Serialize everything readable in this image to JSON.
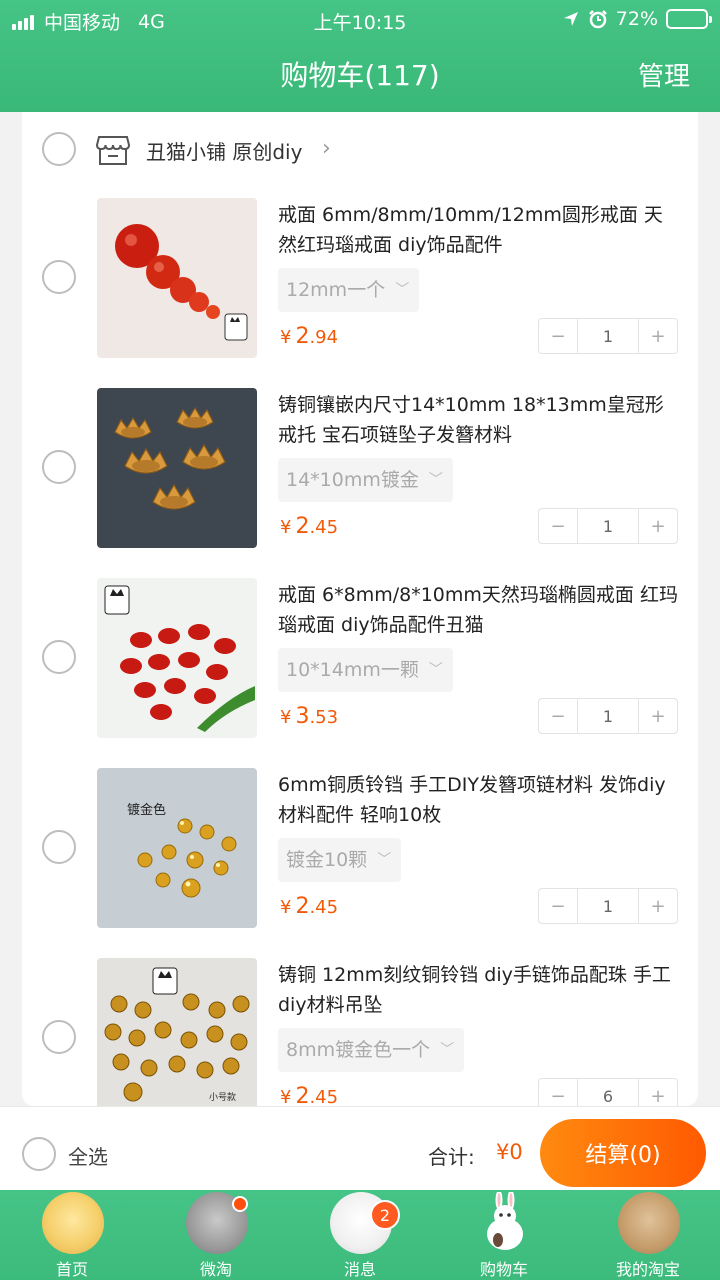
{
  "status_bar": {
    "carrier": "中国移动",
    "network": "4G",
    "time": "上午10:15",
    "battery": "72%",
    "battery_level": 0.72
  },
  "header": {
    "title": "购物车(117)",
    "manage": "管理"
  },
  "store": {
    "name": "丑猫小铺 原创diy",
    "icon": "store-icon"
  },
  "items": [
    {
      "name": "戒面 6mm/8mm/10mm/12mm圆形戒面 天然红玛瑙戒面 diy饰品配件",
      "spec": "12mm一个",
      "price_symbol": "¥",
      "price_int": "2",
      "price_dec": ".94",
      "qty": "1",
      "minus": "−",
      "plus": "+"
    },
    {
      "name": "铸铜镶嵌内尺寸14*10mm 18*13mm皇冠形戒托 宝石项链坠子发簪材料",
      "spec": "14*10mm镀金",
      "price_symbol": "¥",
      "price_int": "2",
      "price_dec": ".45",
      "qty": "1",
      "minus": "−",
      "plus": "+"
    },
    {
      "name": "戒面 6*8mm/8*10mm天然玛瑙椭圆戒面 红玛瑙戒面 diy饰品配件丑猫",
      "spec": "10*14mm一颗",
      "price_symbol": "¥",
      "price_int": "3",
      "price_dec": ".53",
      "qty": "1",
      "minus": "−",
      "plus": "+"
    },
    {
      "name": "6mm铜质铃铛  手工DIY发簪项链材料 发饰diy材料配件 轻响10枚",
      "spec": "镀金10颗",
      "price_symbol": "¥",
      "price_int": "2",
      "price_dec": ".45",
      "qty": "1",
      "minus": "−",
      "plus": "+"
    },
    {
      "name": "铸铜 12mm刻纹铜铃铛 diy手链饰品配珠 手工diy材料吊坠",
      "spec": "8mm镀金色一个",
      "price_symbol": "¥",
      "price_int": "2",
      "price_dec": ".45",
      "qty": "6",
      "minus": "−",
      "plus": "+"
    }
  ],
  "image_captions": {
    "item3_label": "镀金色",
    "item5_label": "小号款"
  },
  "footer": {
    "select_all": "全选",
    "total_label": "合计:",
    "total_value": "¥0",
    "checkout": "结算(0)"
  },
  "tabs": [
    {
      "label": "首页",
      "icon": "home-pet-icon"
    },
    {
      "label": "微淘",
      "icon": "weitao-pet-icon"
    },
    {
      "label": "消息",
      "icon": "message-pet-icon",
      "badge": "2"
    },
    {
      "label": "购物车",
      "icon": "cart-pet-icon"
    },
    {
      "label": "我的淘宝",
      "icon": "profile-pet-icon"
    }
  ],
  "colors": {
    "header": "#3fbf7f",
    "accent": "#f25a0a",
    "checkout": "#ff6a00"
  }
}
